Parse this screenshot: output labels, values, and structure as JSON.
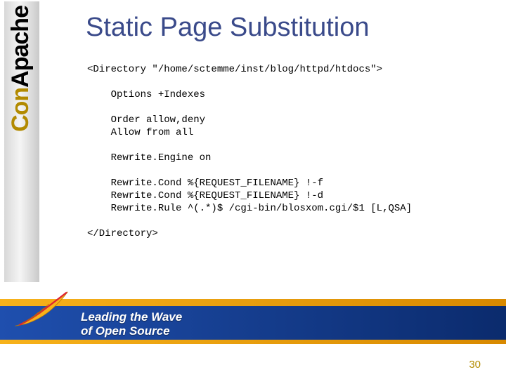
{
  "logo": {
    "word_a": "Apache",
    "word_b": "Con"
  },
  "title": "Static Page Substitution",
  "code": {
    "dir_open": "<Directory \"/home/sctemme/inst/blog/httpd/htdocs\">",
    "opt": "    Options +Indexes",
    "ord": "    Order allow,deny",
    "alw": "    Allow from all",
    "reng": "    Rewrite.Engine on",
    "rc1": "    Rewrite.Cond %{REQUEST_FILENAME} !-f",
    "rc2": "    Rewrite.Cond %{REQUEST_FILENAME} !-d",
    "rr": "    Rewrite.Rule ^(.*)$ /cgi-bin/blosxom.cgi/$1 [L,QSA]",
    "dir_close": "</Directory>"
  },
  "tagline_line1": "Leading the Wave",
  "tagline_line2": "of Open Source",
  "page_number": "30"
}
